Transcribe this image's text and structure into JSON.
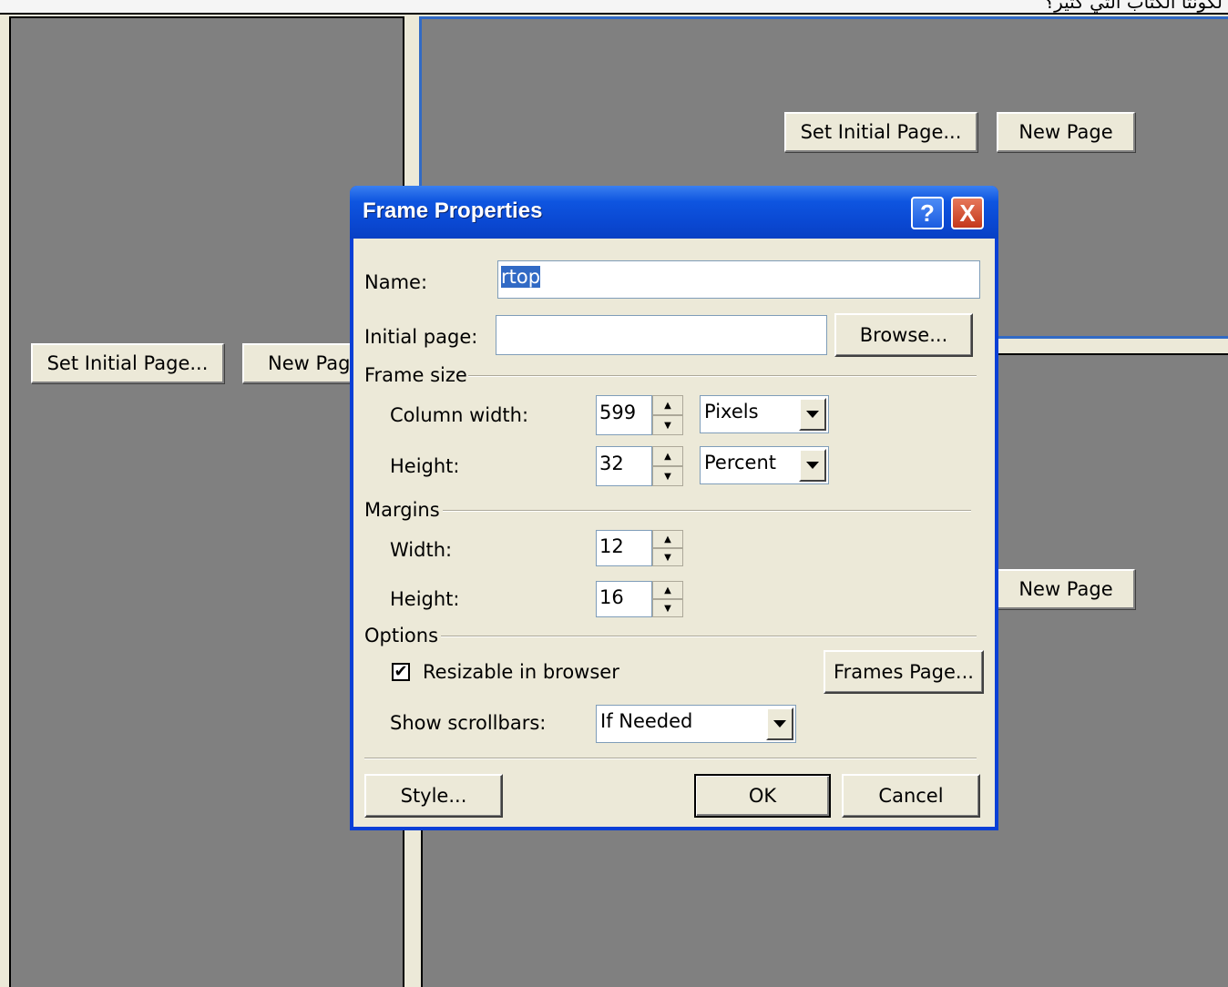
{
  "background": {
    "top_text": "لكونتا الكتاب التي كثير؟",
    "left_frame": {
      "set_initial_label": "Set Initial Page...",
      "new_page_label": "New Page"
    },
    "top_right_frame": {
      "set_initial_label": "Set Initial Page...",
      "new_page_label": "New Page"
    },
    "bottom_right_frame": {
      "new_page_label": "New Page"
    },
    "colors": {
      "frame_fill": "#808080",
      "selected_frame_border": "#316ac5",
      "chrome": "#ece9d8"
    }
  },
  "dialog": {
    "title": "Frame Properties",
    "help_glyph": "?",
    "close_glyph": "X",
    "name": {
      "label": "Name:",
      "value": "rtop"
    },
    "initial_page": {
      "label": "Initial page:",
      "value": "",
      "browse_label": "Browse..."
    },
    "frame_size": {
      "group_label": "Frame size",
      "column_width": {
        "label": "Column width:",
        "value": "599",
        "unit": "Pixels"
      },
      "height": {
        "label": "Height:",
        "value": "32",
        "unit": "Percent"
      }
    },
    "margins": {
      "group_label": "Margins",
      "width": {
        "label": "Width:",
        "value": "12"
      },
      "height": {
        "label": "Height:",
        "value": "16"
      }
    },
    "options": {
      "group_label": "Options",
      "resizable_label": "Resizable in browser",
      "resizable_checked": true,
      "frames_page_label": "Frames Page...",
      "show_scrollbars_label": "Show scrollbars:",
      "show_scrollbars_value": "If Needed"
    },
    "buttons": {
      "style": "Style...",
      "ok": "OK",
      "cancel": "Cancel"
    }
  }
}
